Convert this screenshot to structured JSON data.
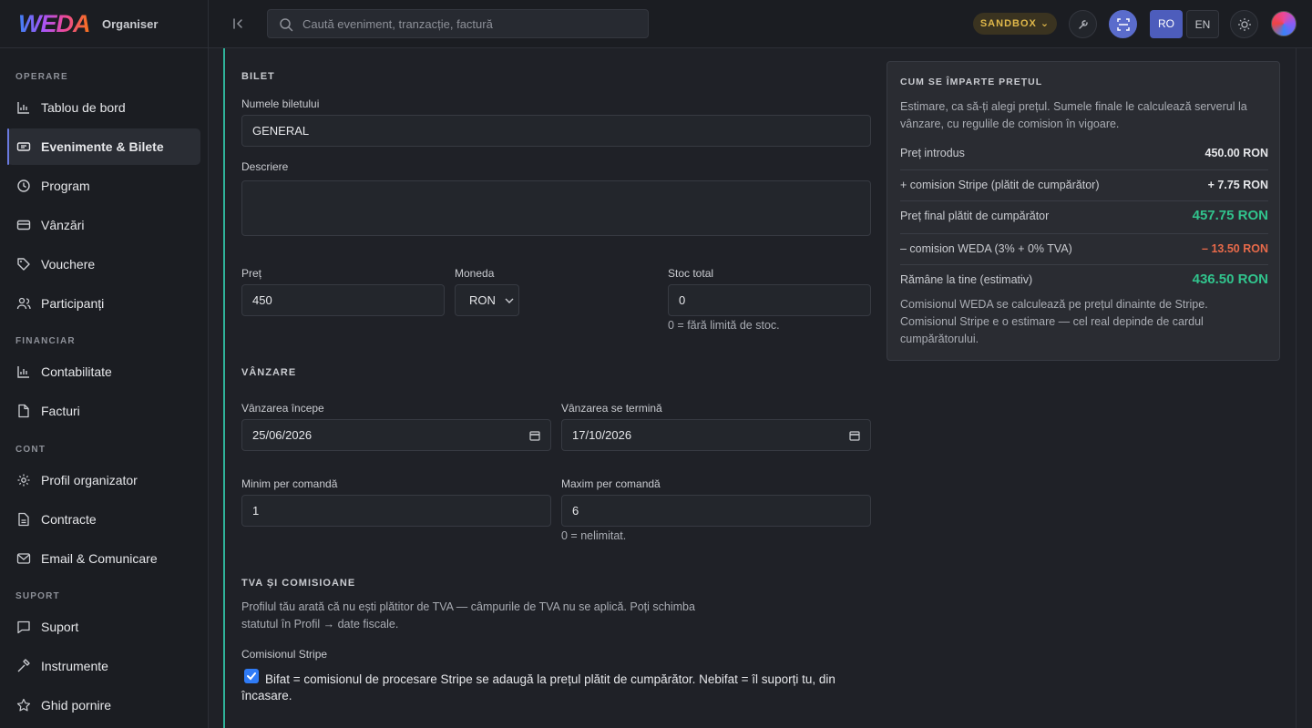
{
  "app": {
    "logo": "WEDA",
    "subtitle": "Organiser"
  },
  "search": {
    "placeholder": "Caută eveniment, tranzacție, factură"
  },
  "header": {
    "env_badge": "SANDBOX",
    "lang_ro": "RO",
    "lang_en": "EN"
  },
  "sidebar": {
    "sections": [
      "OPERARE",
      "FINANCIAR",
      "CONT",
      "SUPORT"
    ],
    "items": [
      {
        "label": "Tablou de bord",
        "icon": "chart-bar-icon"
      },
      {
        "label": "Evenimente & Bilete",
        "icon": "ticket-icon"
      },
      {
        "label": "Program",
        "icon": "clock-icon"
      },
      {
        "label": "Vânzări",
        "icon": "credit-card-icon"
      },
      {
        "label": "Vouchere",
        "icon": "tag-icon"
      },
      {
        "label": "Participanți",
        "icon": "users-icon"
      },
      {
        "label": "Contabilitate",
        "icon": "chart-bar-icon"
      },
      {
        "label": "Facturi",
        "icon": "file-icon"
      },
      {
        "label": "Profil organizator",
        "icon": "gear-icon"
      },
      {
        "label": "Contracte",
        "icon": "document-icon"
      },
      {
        "label": "Email & Comunicare",
        "icon": "mail-icon"
      },
      {
        "label": "Suport",
        "icon": "chat-icon"
      },
      {
        "label": "Instrumente",
        "icon": "hammer-icon"
      },
      {
        "label": "Ghid pornire",
        "icon": "star-icon"
      }
    ]
  },
  "form": {
    "ticket_section": "BILET",
    "name_label": "Numele biletului",
    "name_value": "GENERAL",
    "desc_label": "Descriere",
    "desc_value": "",
    "price_label": "Preț",
    "price_value": "450",
    "currency_label": "Moneda",
    "currency_value": "RON",
    "stock_label": "Stoc total",
    "stock_value": "0",
    "stock_hint": "0 = fără limită de stoc.",
    "sale_section": "VÂNZARE",
    "sale_start_label": "Vânzarea începe",
    "sale_start_value": "25/06/2026",
    "sale_end_label": "Vânzarea se termină",
    "sale_end_value": "17/10/2026",
    "min_label": "Minim per comandă",
    "min_value": "1",
    "max_label": "Maxim per comandă",
    "max_value": "6",
    "max_hint": "0 = nelimitat.",
    "vat_section": "TVA ȘI COMISIOANE",
    "vat_text_1": "Profilul tău arată că nu ești plătitor de TVA — câmpurile de TVA nu se aplică. Poți schimba",
    "vat_text_2": "statutul în Profil → date fiscale.",
    "stripe_label": "Comisionul Stripe",
    "stripe_checked": true,
    "stripe_text": "Bifat = comisionul de procesare Stripe se adaugă la prețul plătit de cumpărător. Nebifat = îl suporți tu, din încasare."
  },
  "summary": {
    "title": "CUM SE ÎMPARTE PREȚUL",
    "intro": "Estimare, ca să-ți alegi prețul. Sumele finale le calculează serverul la vânzare, cu regulile de comision în vigoare.",
    "rows": [
      {
        "label": "Preț introdus",
        "value": "450.00 RON"
      },
      {
        "label": "+ comision Stripe (plătit de cumpărător)",
        "value": "+ 7.75 RON"
      },
      {
        "label": "Preț final plătit de cumpărător",
        "value": "457.75 RON"
      },
      {
        "label": "– comision WEDA (3% + 0% TVA)",
        "value": "– 13.50 RON"
      },
      {
        "label": "Rămâne la tine (estimativ)",
        "value": "436.50 RON"
      }
    ],
    "footnote": "Comisionul WEDA se calculează pe prețul dinainte de Stripe. Comisionul Stripe e o estimare — cel real depinde de cardul cumpărătorului."
  },
  "colors": {
    "accent": "#5a6ccc",
    "positive": "#31c48d",
    "negative": "#e76a4a",
    "sandbox": "#e0b84a",
    "rule": "#2fb39a"
  }
}
